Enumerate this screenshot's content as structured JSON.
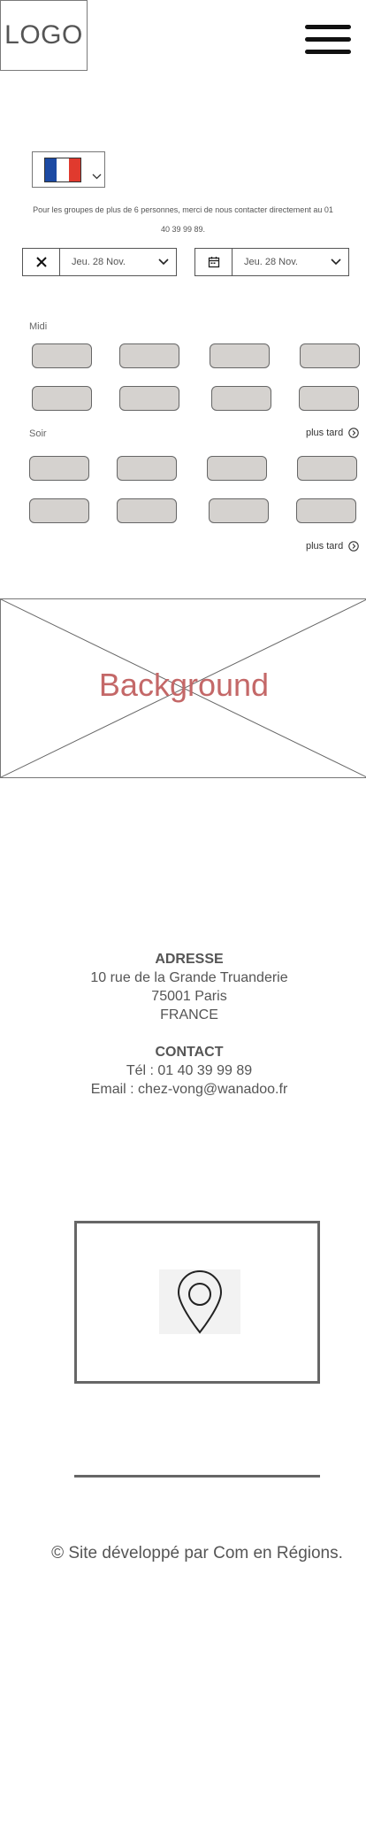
{
  "header": {
    "logo_text": "LOGO",
    "menu_icon": "hamburger-menu-icon"
  },
  "language": {
    "selected": "fr",
    "flag_colors": [
      "#1c4aa3",
      "#ffffff",
      "#e03a2e"
    ],
    "chevron_icon": "chevron-down-icon"
  },
  "notice": {
    "line1": "Pour les groupes de plus de 6 personnes, merci de nous contacter directement au 01",
    "line2": "40 39 99 89."
  },
  "dates": {
    "left": {
      "icon": "close-icon",
      "value": "Jeu. 28 Nov."
    },
    "right": {
      "icon": "calendar-icon",
      "value": "Jeu. 28 Nov."
    }
  },
  "midi": {
    "label": "Midi"
  },
  "soir": {
    "label": "Soir",
    "more_label": "plus tard"
  },
  "bottom_more_label": "plus tard",
  "background": {
    "label": "Background",
    "label_color": "#c46868"
  },
  "address": {
    "heading": "ADRESSE",
    "line1": "10 rue de la Grande Truanderie",
    "line2": "75001 Paris",
    "line3": "FRANCE"
  },
  "contact": {
    "heading": "CONTACT",
    "phone": "Tél : 01 40 39 99 89",
    "email": "Email : chez-vong@wanadoo.fr"
  },
  "map": {
    "icon": "map-pin-icon"
  },
  "footer": {
    "text": "© Site développé par Com en Régions."
  }
}
